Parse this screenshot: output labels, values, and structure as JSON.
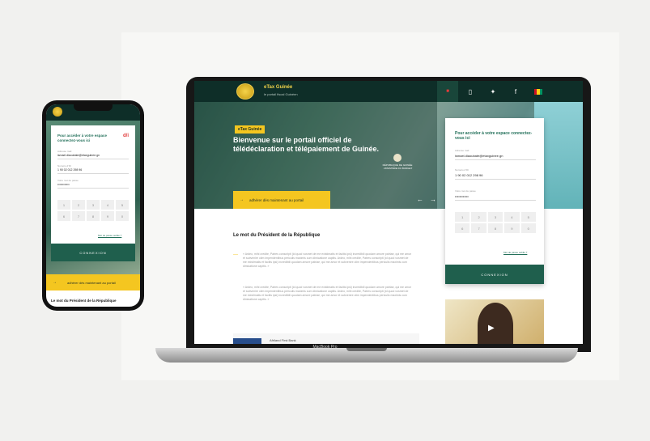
{
  "device_label": "MacBook Pro",
  "brand": {
    "name": "eTax Guinée",
    "tagline": "le portail fiscal Guinéen"
  },
  "nav_icons": [
    "home-icon",
    "mobile-icon",
    "twitter-icon",
    "facebook-icon",
    "flag-icon"
  ],
  "flag_colors": [
    "#ce1126",
    "#fcd116",
    "#009460"
  ],
  "accent_color": "#f4c620",
  "primary_green": "#1f5f4d",
  "hero": {
    "badge": "eTax Guinée",
    "title": "Bienvenue sur le portail officiel de télédéclaration et télépaiement de Guinée.",
    "seal_text": "RÉPUBLIQUE DE GUINÉE · MINISTÈRE DU BUDGET",
    "cta": "adhérer dès maintenant au portail",
    "prev_arrow": "←",
    "next_arrow": "→"
  },
  "login": {
    "title": "Pour accéder à votre espace connectez-vous ici",
    "email_label": "Adresse mail",
    "email_value": "ismael.diaoubate@etaxguinee.gn",
    "tax_label": "Numéro d'ID",
    "tax_value": "1 90 02 012 298 96",
    "password_label": "Votre mot de passe",
    "password_value": "••••••••••••",
    "keypad_laptop": [
      "1",
      "2",
      "3",
      "4",
      "5",
      "6",
      "7",
      "8",
      "9",
      "0"
    ],
    "keypad_phone": [
      "1",
      "2",
      "3",
      "4",
      "5",
      "6",
      "7",
      "8",
      "9",
      "0"
    ],
    "forgot": "Mot de passe oublié ?",
    "submit": "CONNEXION"
  },
  "president": {
    "title": "Le mot du Président de la République",
    "quote_1": "« Ardeo, mihi credite, Patres conscripti (id quod vosmet de me existimatis et facitis ipsi) incredibili quodam amore patriae, qui me amor et subvenire olim impendentibus periculis maximis cum dimicatione capitis. Ardeo, mihi credite, Patres conscripti (id quod vosmet de me existimatis et facitis ipsi) incredibili quodam amore patriae, qui me amor et subvenire olim impendentibus periculis maximis cum dimicatione capitis. »",
    "quote_2": "« Ardeo, mihi credite, Patres conscripti (id quod vosmet de me existimatis et facitis ipsi) incredibili quodam amore patriae, qui me amor et subvenire olim impendentibus periculis maximis cum dimicatione capitis. Ardeo, mihi credite, Patres conscripti (id quod vosmet de me existimatis et facitis ipsi) incredibili quodam amore patriae, qui me amor et subvenire olim impendentibus periculis maximis cum dimicatione capitis. »",
    "partner": "Afriland First Bank"
  },
  "phone": {
    "partner_logo": "d/i",
    "cta": "adhérer dès maintenant au portail",
    "president_title": "Le mot du Président de la République"
  }
}
